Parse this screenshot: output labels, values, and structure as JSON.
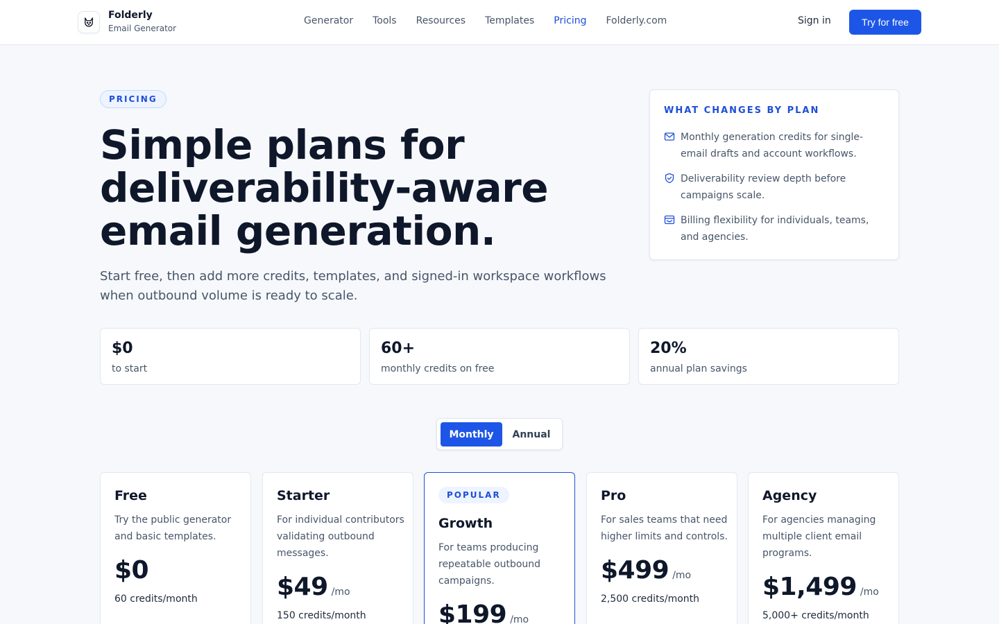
{
  "header": {
    "brand_name": "Folderly",
    "brand_sub": "Email Generator",
    "nav": [
      "Generator",
      "Tools",
      "Resources",
      "Templates",
      "Pricing",
      "Folderly.com"
    ],
    "active_nav": "Pricing",
    "signin_label": "Sign in",
    "try_label": "Try for free"
  },
  "hero": {
    "badge": "PRICING",
    "title": "Simple plans for deliverability-aware email generation.",
    "subtitle": "Start free, then add more credits, templates, and signed-in workspace workflows when outbound volume is ready to scale."
  },
  "changes": {
    "title": "WHAT CHANGES BY PLAN",
    "items": [
      {
        "icon": "mail-icon",
        "text": "Monthly generation credits for single-email drafts and account workflows."
      },
      {
        "icon": "shield-check-icon",
        "text": "Deliverability review depth before campaigns scale."
      },
      {
        "icon": "billing-icon",
        "text": "Billing flexibility for individuals, teams, and agencies."
      }
    ]
  },
  "stats": [
    {
      "value": "$0",
      "label": "to start"
    },
    {
      "value": "60+",
      "label": "monthly credits on free"
    },
    {
      "value": "20%",
      "label": "annual plan savings"
    }
  ],
  "billing_toggle": {
    "monthly": "Monthly",
    "annual": "Annual",
    "selected": "Monthly"
  },
  "plans": [
    {
      "name": "Free",
      "desc": "Try the public generator and basic templates.",
      "price": "$0",
      "per": "",
      "credits": "60 credits/month",
      "popular": false
    },
    {
      "name": "Starter",
      "desc": "For individual contributors validating outbound messages.",
      "price": "$49",
      "per": "/mo",
      "credits": "150 credits/month",
      "popular": false
    },
    {
      "name": "Growth",
      "desc": "For teams producing repeatable outbound campaigns.",
      "price": "$199",
      "per": "/mo",
      "credits": "",
      "popular": true,
      "badge": "POPULAR"
    },
    {
      "name": "Pro",
      "desc": "For sales teams that need higher limits and controls.",
      "price": "$499",
      "per": "/mo",
      "credits": "2,500 credits/month",
      "popular": false
    },
    {
      "name": "Agency",
      "desc": "For agencies managing multiple client email programs.",
      "price": "$1,499",
      "per": "/mo",
      "credits": "5,000+ credits/month",
      "popular": false
    }
  ],
  "colors": {
    "accent": "#1d56e6",
    "accent_text": "#1d4ed8",
    "heading": "#0f172a",
    "body": "#475569",
    "background": "#f6f8fb"
  }
}
